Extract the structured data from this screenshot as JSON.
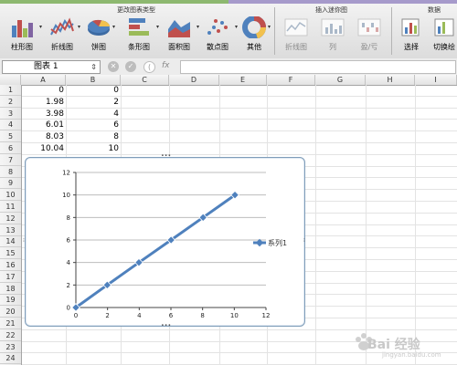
{
  "ribbon": {
    "groups": [
      {
        "title": "更改图表类型"
      },
      {
        "title": "插入迷你图"
      },
      {
        "title": "数据"
      }
    ],
    "buttons": [
      {
        "label": "柱形图"
      },
      {
        "label": "折线图"
      },
      {
        "label": "饼图"
      },
      {
        "label": "条形图"
      },
      {
        "label": "面积图"
      },
      {
        "label": "散点图"
      },
      {
        "label": "其他"
      },
      {
        "label": "折线图"
      },
      {
        "label": "列"
      },
      {
        "label": "盈/亏"
      },
      {
        "label": "选择"
      },
      {
        "label": "切换绘"
      }
    ]
  },
  "formula_bar": {
    "name_box": "图表 1",
    "fx_label": "fx",
    "formula": ""
  },
  "sheet": {
    "columns": [
      "A",
      "B",
      "C",
      "D",
      "E",
      "F",
      "G",
      "H",
      "I"
    ],
    "rows": [
      "1",
      "2",
      "3",
      "4",
      "5",
      "6",
      "7",
      "8",
      "9",
      "10",
      "11",
      "12",
      "13",
      "14",
      "15",
      "16",
      "17",
      "18",
      "19",
      "20",
      "21",
      "22",
      "23",
      "24"
    ],
    "data": [
      {
        "a": "0",
        "b": "0"
      },
      {
        "a": "1.98",
        "b": "2"
      },
      {
        "a": "3.98",
        "b": "4"
      },
      {
        "a": "6.01",
        "b": "6"
      },
      {
        "a": "8.03",
        "b": "8"
      },
      {
        "a": "10.04",
        "b": "10"
      }
    ]
  },
  "chart_data": {
    "type": "scatter",
    "title": "",
    "xlabel": "",
    "ylabel": "",
    "xlim": [
      0,
      12
    ],
    "ylim": [
      0,
      12
    ],
    "x_ticks": [
      "0",
      "2",
      "4",
      "6",
      "8",
      "10",
      "12"
    ],
    "y_ticks": [
      "0",
      "2",
      "4",
      "6",
      "8",
      "10",
      "12"
    ],
    "grid": "horizontal",
    "legend": "right",
    "series": [
      {
        "name": "系列1",
        "x": [
          0,
          1.98,
          3.98,
          6.01,
          8.03,
          10.04
        ],
        "y": [
          0,
          2,
          4,
          6,
          8,
          10
        ],
        "color": "#4f81bd"
      }
    ]
  },
  "watermark": {
    "text": "Bai 经验",
    "sub": "jingyan.baidu.com"
  }
}
